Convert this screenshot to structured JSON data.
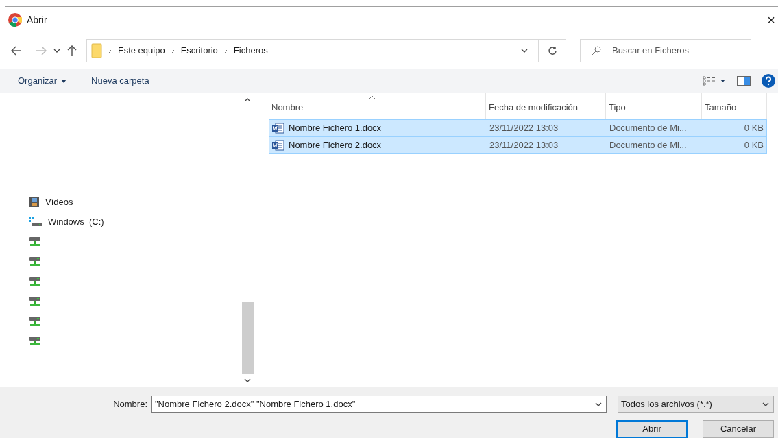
{
  "window": {
    "title": "Abrir",
    "close": "×"
  },
  "address": {
    "path": [
      "Este equipo",
      "Escritorio",
      "Ficheros"
    ]
  },
  "search": {
    "placeholder": "Buscar en Ficheros"
  },
  "toolbar": {
    "organize": "Organizar",
    "new_folder": "Nueva carpeta"
  },
  "sidebar": {
    "items": [
      {
        "kind": "videos",
        "label": "Vídeos"
      },
      {
        "kind": "drive",
        "label": "Windows  (C:)"
      },
      {
        "kind": "network"
      },
      {
        "kind": "network"
      },
      {
        "kind": "network"
      },
      {
        "kind": "network"
      },
      {
        "kind": "network"
      },
      {
        "kind": "network"
      }
    ]
  },
  "table": {
    "columns": [
      "Nombre",
      "Fecha de modificación",
      "Tipo",
      "Tamaño"
    ],
    "rows": [
      {
        "name": "Nombre Fichero 1.docx",
        "date": "23/11/2022 13:03",
        "type": "Documento de Mi...",
        "size": "0 KB",
        "selected": true
      },
      {
        "name": "Nombre Fichero 2.docx",
        "date": "23/11/2022 13:03",
        "type": "Documento de Mi...",
        "size": "0 KB",
        "selected": true
      }
    ]
  },
  "footer": {
    "name_label": "Nombre:",
    "name_value": "\"Nombre Fichero 2.docx\" \"Nombre Fichero 1.docx\"",
    "filter": "Todos los archivos (*.*)",
    "buttons": [
      {
        "label": "Abrir",
        "kind": "primary"
      },
      {
        "label": "Cancelar",
        "kind": "secondary"
      }
    ]
  }
}
